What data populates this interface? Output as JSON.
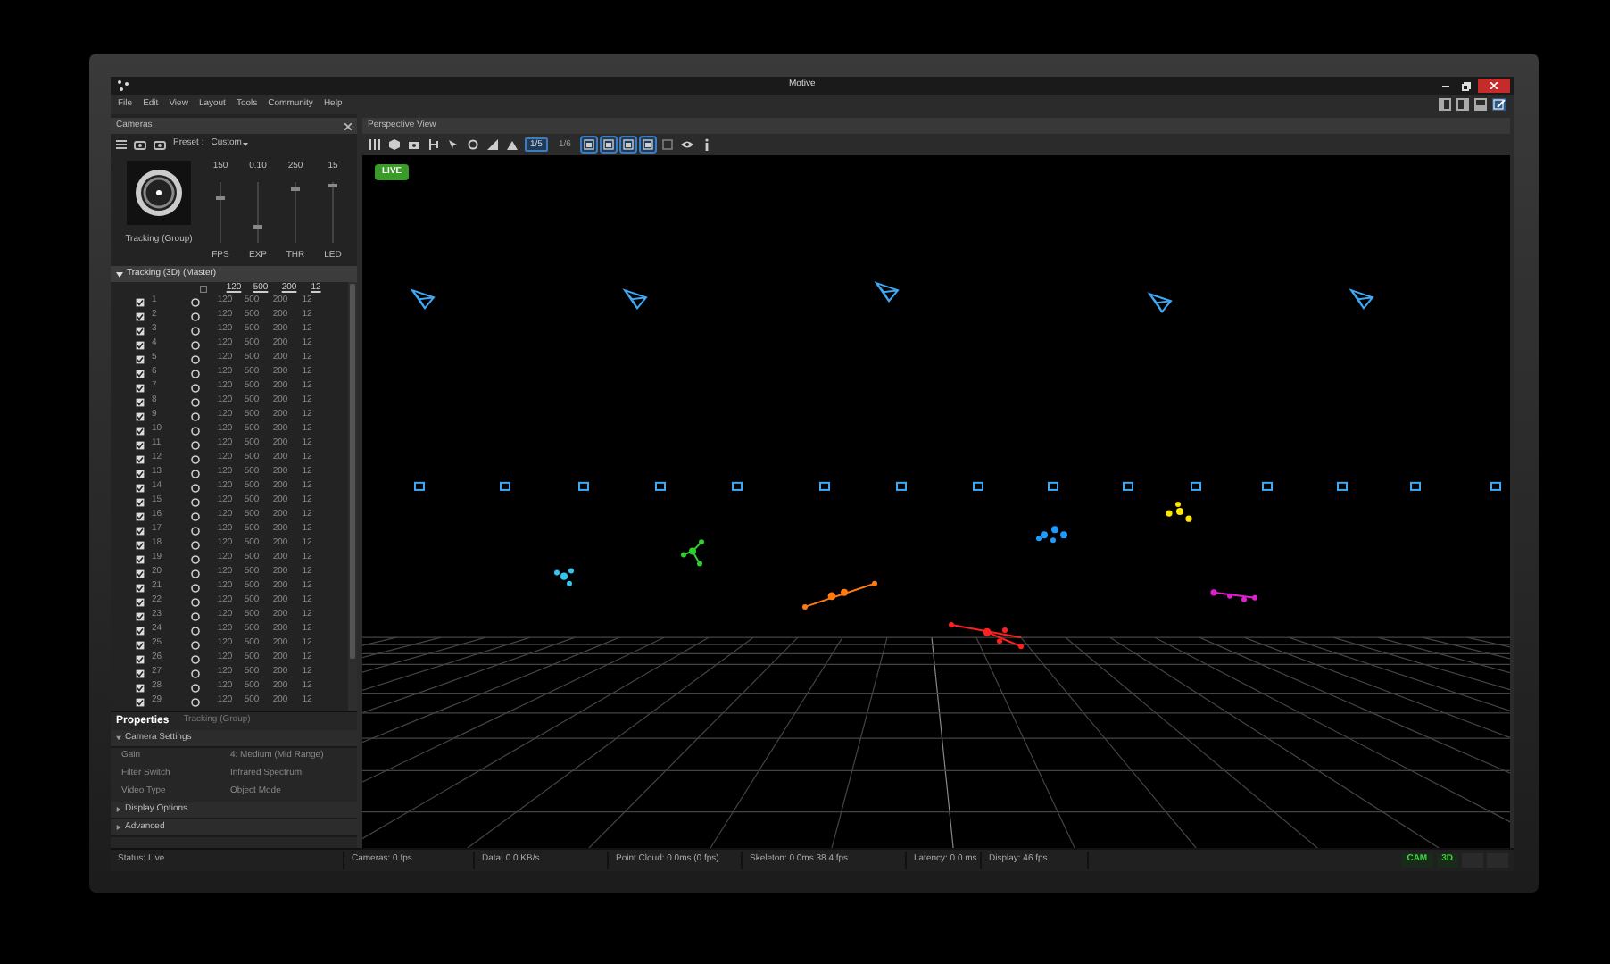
{
  "window": {
    "title": "Motive"
  },
  "menu": [
    "File",
    "Edit",
    "View",
    "Layout",
    "Tools",
    "Community",
    "Help"
  ],
  "cameras_panel": {
    "title": "Cameras",
    "preset_label": "Preset :",
    "preset_value": "Custom",
    "preview_label": "Tracking (Group)",
    "sliders": [
      {
        "value": "150",
        "label": "FPS",
        "level": 0.75
      },
      {
        "value": "0.10",
        "label": "EXP",
        "level": 0.25
      },
      {
        "value": "250",
        "label": "THR",
        "level": 0.9
      },
      {
        "value": "15",
        "label": "LED",
        "level": 0.95
      }
    ]
  },
  "group": {
    "label": "Tracking (3D) (Master)",
    "expanded": true,
    "all_checked": false,
    "header": [
      "120",
      "500",
      "200",
      "12"
    ]
  },
  "cameras": [
    {
      "checked": true,
      "number": "1",
      "values": [
        "120",
        "500",
        "200",
        "12"
      ]
    },
    {
      "checked": true,
      "number": "2",
      "values": [
        "120",
        "500",
        "200",
        "12"
      ]
    },
    {
      "checked": true,
      "number": "3",
      "values": [
        "120",
        "500",
        "200",
        "12"
      ]
    },
    {
      "checked": true,
      "number": "4",
      "values": [
        "120",
        "500",
        "200",
        "12"
      ]
    },
    {
      "checked": true,
      "number": "5",
      "values": [
        "120",
        "500",
        "200",
        "12"
      ]
    },
    {
      "checked": true,
      "number": "6",
      "values": [
        "120",
        "500",
        "200",
        "12"
      ]
    },
    {
      "checked": true,
      "number": "7",
      "values": [
        "120",
        "500",
        "200",
        "12"
      ]
    },
    {
      "checked": true,
      "number": "8",
      "values": [
        "120",
        "500",
        "200",
        "12"
      ]
    },
    {
      "checked": true,
      "number": "9",
      "values": [
        "120",
        "500",
        "200",
        "12"
      ]
    },
    {
      "checked": true,
      "number": "10",
      "values": [
        "120",
        "500",
        "200",
        "12"
      ]
    },
    {
      "checked": true,
      "number": "11",
      "values": [
        "120",
        "500",
        "200",
        "12"
      ]
    },
    {
      "checked": true,
      "number": "12",
      "values": [
        "120",
        "500",
        "200",
        "12"
      ]
    },
    {
      "checked": true,
      "number": "13",
      "values": [
        "120",
        "500",
        "200",
        "12"
      ]
    },
    {
      "checked": true,
      "number": "14",
      "values": [
        "120",
        "500",
        "200",
        "12"
      ]
    },
    {
      "checked": true,
      "number": "15",
      "values": [
        "120",
        "500",
        "200",
        "12"
      ]
    },
    {
      "checked": true,
      "number": "16",
      "values": [
        "120",
        "500",
        "200",
        "12"
      ]
    },
    {
      "checked": true,
      "number": "17",
      "values": [
        "120",
        "500",
        "200",
        "12"
      ]
    },
    {
      "checked": true,
      "number": "18",
      "values": [
        "120",
        "500",
        "200",
        "12"
      ]
    },
    {
      "checked": true,
      "number": "19",
      "values": [
        "120",
        "500",
        "200",
        "12"
      ]
    },
    {
      "checked": true,
      "number": "20",
      "values": [
        "120",
        "500",
        "200",
        "12"
      ]
    },
    {
      "checked": true,
      "number": "21",
      "values": [
        "120",
        "500",
        "200",
        "12"
      ]
    },
    {
      "checked": true,
      "number": "22",
      "values": [
        "120",
        "500",
        "200",
        "12"
      ]
    },
    {
      "checked": true,
      "number": "23",
      "values": [
        "120",
        "500",
        "200",
        "12"
      ]
    },
    {
      "checked": true,
      "number": "24",
      "values": [
        "120",
        "500",
        "200",
        "12"
      ]
    },
    {
      "checked": true,
      "number": "25",
      "values": [
        "120",
        "500",
        "200",
        "12"
      ]
    },
    {
      "checked": true,
      "number": "26",
      "values": [
        "120",
        "500",
        "200",
        "12"
      ]
    },
    {
      "checked": true,
      "number": "27",
      "values": [
        "120",
        "500",
        "200",
        "12"
      ]
    },
    {
      "checked": true,
      "number": "28",
      "values": [
        "120",
        "500",
        "200",
        "12"
      ]
    },
    {
      "checked": true,
      "number": "29",
      "values": [
        "120",
        "500",
        "200",
        "12"
      ]
    }
  ],
  "properties": {
    "tabs": [
      {
        "label": "Properties",
        "selected": true
      },
      {
        "label": "Tracking (Group)",
        "selected": false
      }
    ],
    "sections": [
      {
        "title": "Camera Settings",
        "expanded": true,
        "rows": [
          {
            "name": "Gain",
            "value": "4: Medium (Mid Range)"
          },
          {
            "name": "Filter Switch",
            "value": "Infrared Spectrum"
          },
          {
            "name": "Video Type",
            "value": "Object Mode"
          }
        ]
      },
      {
        "title": "Display Options",
        "expanded": false
      },
      {
        "title": "Advanced",
        "expanded": false
      }
    ]
  },
  "view": {
    "title": "Perspective View",
    "live_badge": "LIVE",
    "toolbar": [
      {
        "kind": "icon",
        "selected": false
      },
      {
        "kind": "icon",
        "selected": false
      },
      {
        "kind": "icon",
        "selected": false
      },
      {
        "kind": "icon",
        "selected": false
      },
      {
        "kind": "icon",
        "selected": false
      },
      {
        "kind": "icon",
        "selected": false
      },
      {
        "kind": "icon",
        "selected": false
      },
      {
        "kind": "icon",
        "selected": false
      },
      {
        "kind": "text",
        "label": "1/5",
        "selected": true
      },
      {
        "kind": "text",
        "label": "1/6",
        "selected": false
      },
      {
        "kind": "icon",
        "selected": true
      },
      {
        "kind": "icon",
        "selected": true
      },
      {
        "kind": "icon",
        "selected": true
      },
      {
        "kind": "icon",
        "selected": true
      },
      {
        "kind": "icon",
        "selected": false
      },
      {
        "kind": "icon",
        "selected": false
      },
      {
        "kind": "icon",
        "selected": false
      }
    ]
  },
  "status_bar": {
    "items": [
      "Status: Live",
      "Cameras: 0 fps",
      "Data: 0.0 KB/s",
      "Point Cloud: 0.0ms (0 fps)",
      "Skeleton: 0.0ms 38.4 fps",
      "Latency: 0.0 ms",
      "Display: 46 fps"
    ],
    "indicators": [
      {
        "label": "CAM",
        "on": true
      },
      {
        "label": "3D",
        "on": true
      }
    ]
  }
}
